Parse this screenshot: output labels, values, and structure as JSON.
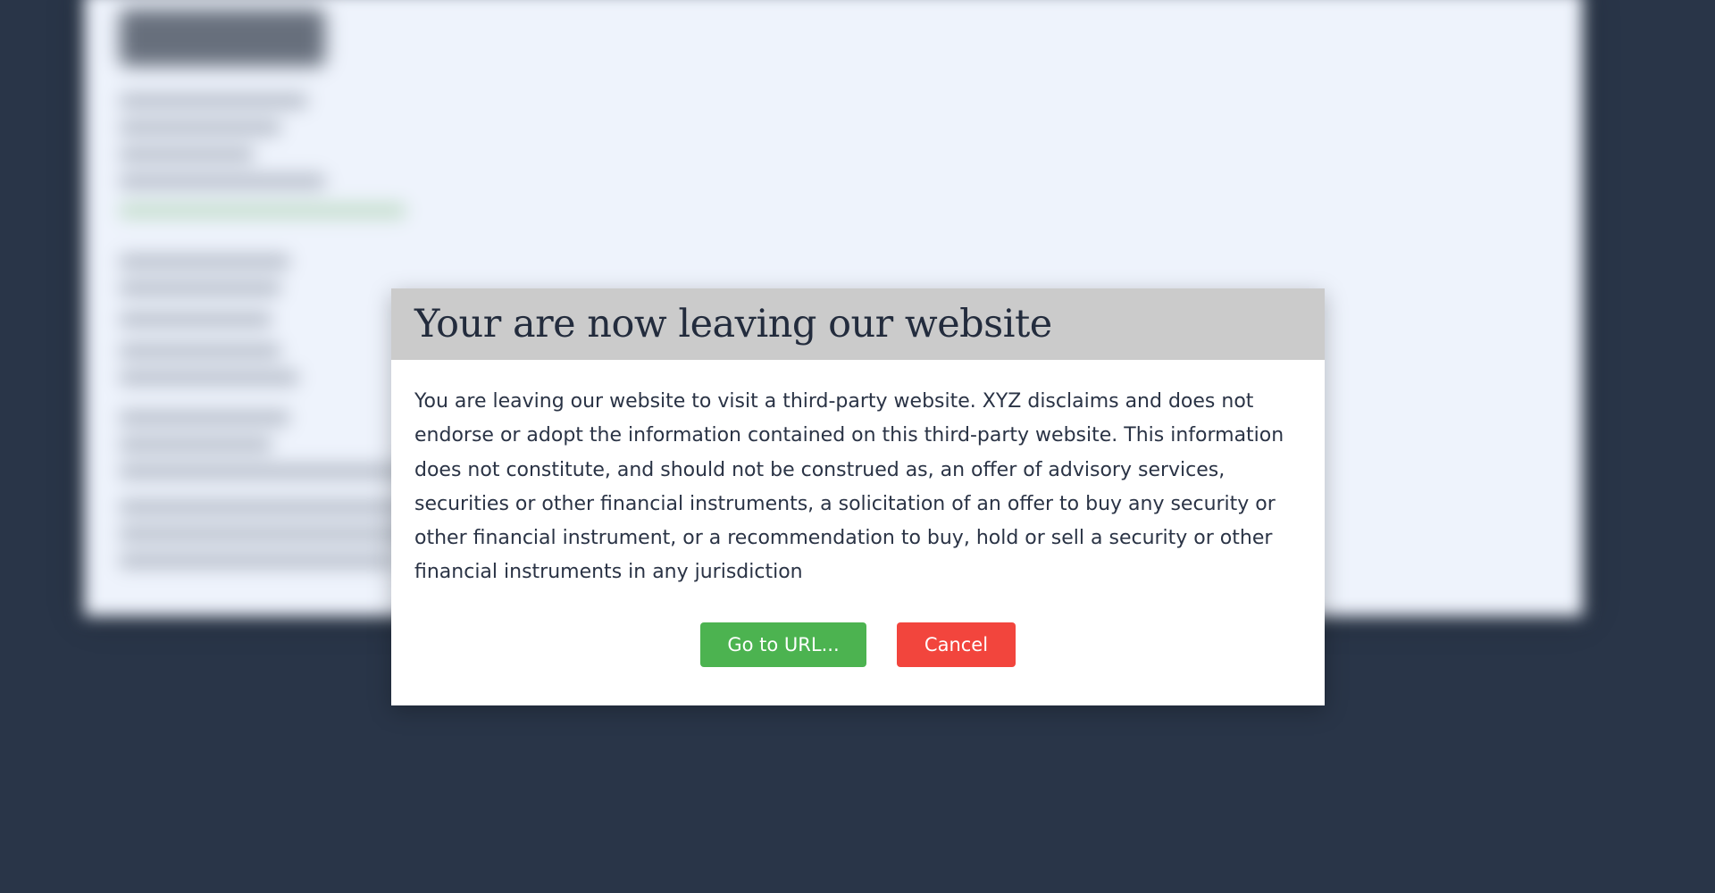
{
  "dialog": {
    "title": "Your are now leaving our website",
    "message": "You are leaving our website to visit a third-party website. XYZ disclaims and does not endorse or adopt the information contained on this third-party website. This information does not constitute, and should not be construed as, an offer of advisory services, securities or other financial instruments, a solicitation of an offer to buy any security or other financial instrument, or a recommendation to buy, hold or sell a security or other financial instruments in any jurisdiction",
    "go_button_label": "Go to URL...",
    "cancel_button_label": "Cancel"
  },
  "colors": {
    "backdrop": "#293548",
    "header_bg": "#cbcbcb",
    "go_button": "#4cb350",
    "cancel_button": "#f2453d"
  }
}
